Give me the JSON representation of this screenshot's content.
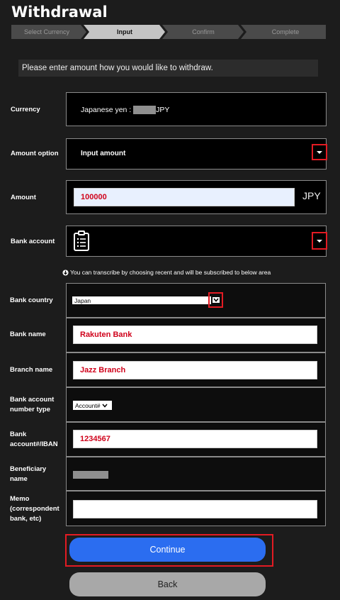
{
  "page": {
    "title": "Withdrawal"
  },
  "stepper": {
    "steps": [
      "Select Currency",
      "Input",
      "Confirm",
      "Complete"
    ],
    "active_index": 1
  },
  "notice": "Please enter amount how you would like to withdraw.",
  "form": {
    "currency": {
      "label": "Currency",
      "prefix": "Japanese yen : ",
      "suffix": "JPY"
    },
    "amount_option": {
      "label": "Amount option",
      "value": "Input amount"
    },
    "amount": {
      "label": "Amount",
      "value": "100000",
      "unit": "JPY"
    },
    "bank_account": {
      "label": "Bank account"
    },
    "hint": "You can transcribe by choosing recent and will be subscribed to below area",
    "bank_country": {
      "label": "Bank country",
      "value": "Japan"
    },
    "bank_name": {
      "label": "Bank name",
      "value": "Rakuten Bank"
    },
    "branch_name": {
      "label": "Branch name",
      "value": "Jazz Branch"
    },
    "account_type": {
      "label_line1": "Bank account",
      "label_line2": "number type",
      "value": "Account#"
    },
    "account_number": {
      "label_line1": "Bank",
      "label_line2": "account#/IBAN",
      "value": "1234567"
    },
    "beneficiary": {
      "label_line1": "Beneficiary",
      "label_line2": "name"
    },
    "memo": {
      "label_line1": "Memo",
      "label_line2": "(correspondent",
      "label_line3": "bank, etc)",
      "value": ""
    }
  },
  "buttons": {
    "continue": "Continue",
    "back": "Back"
  },
  "colors": {
    "primary": "#2b6df0",
    "highlight": "#e31b23",
    "input_text": "#d0021b"
  }
}
